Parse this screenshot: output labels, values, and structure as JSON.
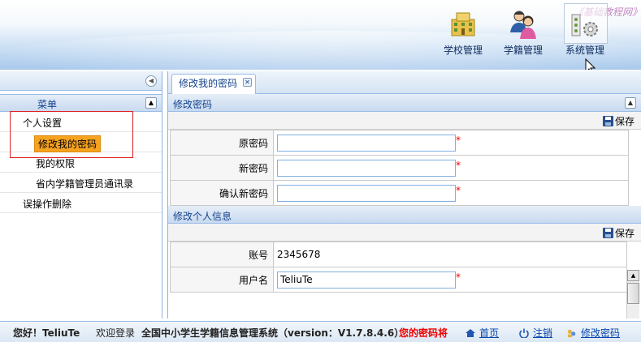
{
  "header": {
    "watermark": "《基础教程网》",
    "nav": [
      {
        "label": "学校管理",
        "icon": "school-building-icon"
      },
      {
        "label": "学籍管理",
        "icon": "users-icon"
      },
      {
        "label": "系统管理",
        "icon": "system-settings-icon"
      }
    ]
  },
  "sidebar": {
    "menu_title": "菜单",
    "items": [
      {
        "label": "个人设置"
      },
      {
        "label": "修改我的密码"
      },
      {
        "label": "我的权限"
      },
      {
        "label": "省内学籍管理员通讯录"
      },
      {
        "label": "误操作删除"
      }
    ]
  },
  "main": {
    "tab_label": "修改我的密码",
    "password_section": {
      "title": "修改密码",
      "save_label": "保存",
      "fields": [
        {
          "label": "原密码",
          "value": ""
        },
        {
          "label": "新密码",
          "value": ""
        },
        {
          "label": "确认新密码",
          "value": ""
        }
      ],
      "required_mark": "*"
    },
    "info_section": {
      "title": "修改个人信息",
      "save_label": "保存",
      "account_label": "账号",
      "account_value": "2345678",
      "username_label": "用户名",
      "username_value": "TeliuTe",
      "required_mark": "*"
    }
  },
  "statusbar": {
    "greeting": "您好！TeliuTe",
    "welcome": "欢迎登录",
    "system": "全国中小学生学籍信息管理系统（version：V1.7.8.4.6）",
    "warning": "您的密码将",
    "home": "首页",
    "logout": "注销",
    "change_password": "修改密码"
  },
  "colors": {
    "accent": "#15428b",
    "active_item": "#f7a320",
    "warning": "#ee0000",
    "link": "#0645ad"
  }
}
